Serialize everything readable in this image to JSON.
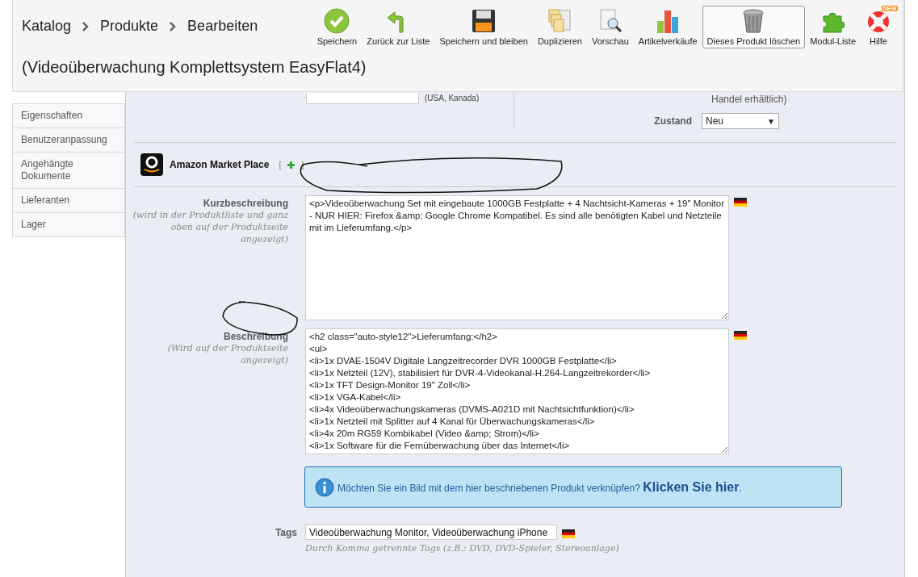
{
  "header": {
    "breadcrumb": [
      "Katalog",
      "Produkte",
      "Bearbeiten"
    ],
    "title": "(Videoüberwachung Komplettsystem EasyFlat4)"
  },
  "toolbar": [
    {
      "label": "Speichern",
      "kind": "check",
      "highlighted": false
    },
    {
      "label": "Zurück zur Liste",
      "kind": "back",
      "highlighted": false
    },
    {
      "label": "Speichern und bleiben",
      "kind": "disk",
      "highlighted": false
    },
    {
      "label": "Duplizieren",
      "kind": "copy",
      "highlighted": false
    },
    {
      "label": "Vorschau",
      "kind": "preview",
      "highlighted": false
    },
    {
      "label": "Artikelverkäufe",
      "kind": "chart",
      "highlighted": false
    },
    {
      "label": "Dieses Produkt löschen",
      "kind": "trash",
      "highlighted": true
    },
    {
      "label": "Modul-Liste",
      "kind": "puzzle",
      "highlighted": false
    },
    {
      "label": "Hilfe",
      "kind": "help",
      "highlighted": false,
      "badge": "NEW"
    }
  ],
  "sidebar": [
    {
      "label": "Eigenschaften"
    },
    {
      "label": "Benutzeranpassung"
    },
    {
      "label": "Angehängte Dokumente"
    },
    {
      "label": "Lieferanten"
    },
    {
      "label": "Lager"
    }
  ],
  "upc": {
    "hint": "(USA, Kanada)"
  },
  "options_tail": "Handel erhältlich)",
  "condition": {
    "label": "Zustand",
    "value": "Neu",
    "arrow": "▼"
  },
  "amazon": {
    "title": "Amazon Market Place",
    "bracket_open": "[",
    "bracket_close": "]"
  },
  "short_description": {
    "label": "Kurzbeschreibung",
    "hint": "(wird in der Produktliste und ganz oben auf der Produktseite angezeigt)",
    "value": "<p>Videoüberwachung Set mit eingebaute 1000GB Festplatte + 4 Nachtsicht-Kameras + 19\" Monitor - NUR HIER: Firefox &amp; Google Chrome Kompatibel. Es sind alle benötigten Kabel und Netzteile mit im Lieferumfang.</p>"
  },
  "description": {
    "label": "Beschreibung",
    "hint": "(Wird auf der Produktseite angezeigt)",
    "lines": [
      "<h2 class=\"auto-style12\">Lieferumfang:</h2>",
      "<ul>",
      "<li>1x DVAE-1504V Digitale Langzeitrecorder DVR 1000GB Festplatte</li>",
      "<li>1x Netzteil (12V), stabilisiert für DVR-4-Videokanal-H.264-Langzeitrekorder</li>",
      "<li>1x TFT Design-Monitor 19\" Zoll</li>",
      "<li>1x VGA-Kabel</li>",
      "<li>4x Videoüberwachungskameras (DVMS-A021D mit Nachtsichtfunktion)</li>",
      "<li>1x Netzteil mit Splitter auf 4 Kanal für Überwachungskameras</li>",
      "<li>4x 20m RG59 Kombikabel (Video &amp; Strom)</li>",
      "<li>1x Software für die Fernüberwachung über das Internet</li>"
    ]
  },
  "info": {
    "text": "Möchten Sie ein Bild mit dem hier beschriebenen Produkt verknüpfen?",
    "link": "Klicken Sie hier",
    "suffix": "."
  },
  "tags": {
    "label": "Tags",
    "value": "Videoüberwachung Monitor, Videoüberwachung iPhone",
    "hint": "Durch Komma getrennte Tags (z.B.: DVD, DVD-Spieler, Stereoanlage)"
  }
}
